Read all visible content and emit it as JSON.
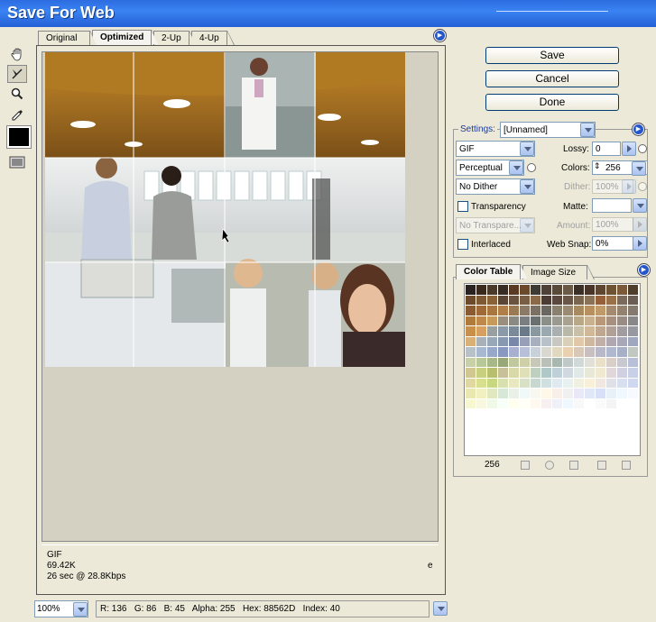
{
  "window": {
    "title": "Save For Web"
  },
  "tabs": [
    {
      "label": "Original"
    },
    {
      "label": "Optimized"
    },
    {
      "label": "2-Up"
    },
    {
      "label": "4-Up"
    }
  ],
  "tools": [
    "hand-icon",
    "slice-select-icon",
    "zoom-icon",
    "eyedropper-icon",
    "eyedropper-color-icon",
    "toggle-slices-icon"
  ],
  "buttons": {
    "save": "Save",
    "cancel": "Cancel",
    "done": "Done"
  },
  "settings": {
    "label": "Settings:",
    "preset": "[Unnamed]",
    "format": "GIF",
    "reduction": "Perceptual",
    "dither_algorithm": "No Dither",
    "transparency_dither": "No Transpare...",
    "lossy_label": "Lossy:",
    "lossy": "0",
    "colors_label": "Colors:",
    "colors": "256",
    "dither_label": "Dither:",
    "dither": "100%",
    "matte_label": "Matte:",
    "matte": "",
    "amount_label": "Amount:",
    "amount": "100%",
    "web_snap_label": "Web Snap:",
    "web_snap": "0%",
    "transparency_label": "Transparency",
    "interlaced_label": "Interlaced",
    "transparency_checked": false,
    "interlaced_checked": false
  },
  "color_panel": {
    "tabs": [
      "Color Table",
      "Image Size"
    ],
    "count": "256",
    "swatches": [
      "#2a2220",
      "#3a2a1e",
      "#4a3a2a",
      "#362c24",
      "#5a3a22",
      "#6a4a2a",
      "#3e3a34",
      "#4e4238",
      "#5a4a3a",
      "#6a5a48",
      "#3a3028",
      "#4a3628",
      "#5e4630",
      "#6e5234",
      "#7a5a38",
      "#503e2c",
      "#6e4a2c",
      "#7e5a34",
      "#8a6238",
      "#5a4436",
      "#6a5240",
      "#7a5e44",
      "#8a6a48",
      "#4a3c34",
      "#5a483e",
      "#6a5648",
      "#7a6650",
      "#8a7258",
      "#96603a",
      "#9a7048",
      "#7a6a5c",
      "#6a5e54",
      "#8a5a30",
      "#a06a38",
      "#aa7640",
      "#b07e48",
      "#9a7a54",
      "#8a7a66",
      "#7a7064",
      "#6a6660",
      "#8a8070",
      "#9a8a74",
      "#a88a60",
      "#b89060",
      "#c09a68",
      "#a48a70",
      "#948270",
      "#847a70",
      "#b07a3a",
      "#c0884a",
      "#c89a5a",
      "#9a8e7e",
      "#8a8a82",
      "#7a7e80",
      "#6a7070",
      "#8a9088",
      "#9a9a90",
      "#aaa290",
      "#b8a888",
      "#c8b090",
      "#b89878",
      "#a89080",
      "#988c84",
      "#888888",
      "#c8904a",
      "#d8a060",
      "#9aa0a0",
      "#8a9aa8",
      "#7a8a98",
      "#6a7a88",
      "#8a98a0",
      "#9aa8b0",
      "#aab0b0",
      "#bab8a8",
      "#c8c0a8",
      "#d0b898",
      "#c0a890",
      "#b0a098",
      "#a09ca0",
      "#9898a0",
      "#d8b078",
      "#a8b0b8",
      "#98a8b8",
      "#8898b0",
      "#7888a8",
      "#98a0b8",
      "#a8b0c0",
      "#b8c0c8",
      "#c8c8c0",
      "#d8d0b8",
      "#e0c8a8",
      "#d0b8a0",
      "#c0b0a8",
      "#b0a8b0",
      "#a8a8b8",
      "#a0a8c0",
      "#b8c0c8",
      "#a8b8d0",
      "#98a8c8",
      "#8898c0",
      "#a8b0d0",
      "#b8c0d8",
      "#c8d0d8",
      "#d8d8d0",
      "#e0d8c0",
      "#e8d0b0",
      "#d8c8b8",
      "#c8c0c0",
      "#b8b8c8",
      "#b0b8d0",
      "#a8b0c8",
      "#c0c8c0",
      "#c8d0a8",
      "#b8c898",
      "#a8b888",
      "#98a878",
      "#c0c8a0",
      "#d0d0a8",
      "#c8c8b8",
      "#b8c0b8",
      "#a8b8b0",
      "#c0c8c8",
      "#d0d8d8",
      "#e0e0d8",
      "#e8e0c8",
      "#d8d0c8",
      "#c8c8d0",
      "#b8c0d8",
      "#d0c890",
      "#c8d080",
      "#b8c070",
      "#c8c098",
      "#d8d8a8",
      "#e0e0b8",
      "#c0d0c0",
      "#b0c8c8",
      "#c0d0d8",
      "#d0d8e0",
      "#e0e8e8",
      "#e8e8d8",
      "#f0e8d0",
      "#e0d8d8",
      "#d0d0e0",
      "#c8d0e8",
      "#e0d8a0",
      "#d8e090",
      "#c8d880",
      "#d8e0b0",
      "#e8e8c0",
      "#d8e0c8",
      "#c8d8d0",
      "#d0e0e0",
      "#e0e8f0",
      "#e8f0f0",
      "#f0f0e0",
      "#f8f0d8",
      "#f0e8e0",
      "#e0e0e8",
      "#d8e0f0",
      "#d0d8f0",
      "#e8e8b0",
      "#f0f0c0",
      "#e0e8c0",
      "#d8e8d8",
      "#e8f0e8",
      "#f0f8f8",
      "#f8f8f0",
      "#fff8e8",
      "#f8f0e8",
      "#f0f0f0",
      "#e8e8f8",
      "#e0e8f8",
      "#d8e0f8",
      "#e8f0f8",
      "#f0f8ff",
      "#f8f8ff",
      "#f8f8d0",
      "#f8f8e0",
      "#f0f8e8",
      "#f8fff8",
      "#fffff0",
      "#fffff8",
      "#fff8f0",
      "#f8f0f0",
      "#f0f0f8",
      "#f0f8ff",
      "#f8f8f8",
      "#ffffff",
      "#fafafa",
      "#f4f4f4",
      "#ffffff",
      "#ffffff"
    ]
  },
  "info": {
    "format": "GIF",
    "size": "69.42K",
    "time": "26 sec @ 28.8Kbps",
    "right_char": "e"
  },
  "status": {
    "zoom": "100%",
    "r_label": "R:",
    "r": "136",
    "g_label": "G:",
    "g": "86",
    "b_label": "B:",
    "b": "45",
    "alpha_label": "Alpha:",
    "alpha": "255",
    "hex_label": "Hex:",
    "hex": "88562D",
    "index_label": "Index:",
    "index": "40"
  }
}
